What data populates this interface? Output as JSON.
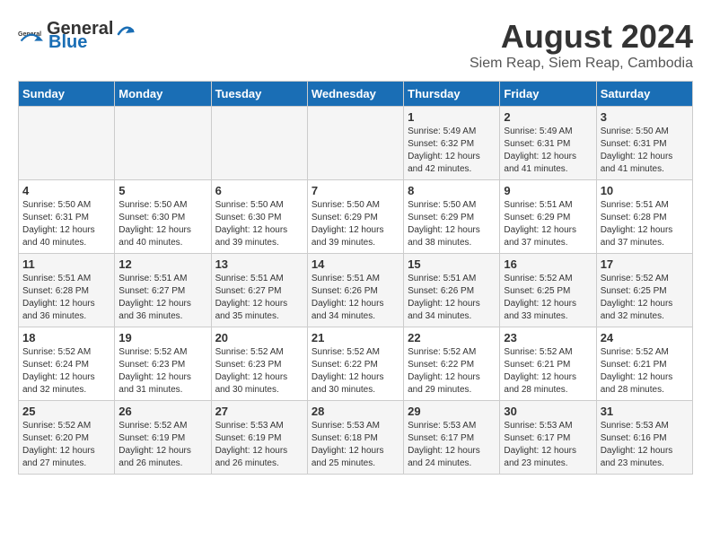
{
  "header": {
    "logo_general": "General",
    "logo_blue": "Blue",
    "month_year": "August 2024",
    "location": "Siem Reap, Siem Reap, Cambodia"
  },
  "days_of_week": [
    "Sunday",
    "Monday",
    "Tuesday",
    "Wednesday",
    "Thursday",
    "Friday",
    "Saturday"
  ],
  "weeks": [
    [
      {
        "day": "",
        "sunrise": "",
        "sunset": "",
        "daylight": ""
      },
      {
        "day": "",
        "sunrise": "",
        "sunset": "",
        "daylight": ""
      },
      {
        "day": "",
        "sunrise": "",
        "sunset": "",
        "daylight": ""
      },
      {
        "day": "",
        "sunrise": "",
        "sunset": "",
        "daylight": ""
      },
      {
        "day": "1",
        "sunrise": "Sunrise: 5:49 AM",
        "sunset": "Sunset: 6:32 PM",
        "daylight": "Daylight: 12 hours and 42 minutes."
      },
      {
        "day": "2",
        "sunrise": "Sunrise: 5:49 AM",
        "sunset": "Sunset: 6:31 PM",
        "daylight": "Daylight: 12 hours and 41 minutes."
      },
      {
        "day": "3",
        "sunrise": "Sunrise: 5:50 AM",
        "sunset": "Sunset: 6:31 PM",
        "daylight": "Daylight: 12 hours and 41 minutes."
      }
    ],
    [
      {
        "day": "4",
        "sunrise": "Sunrise: 5:50 AM",
        "sunset": "Sunset: 6:31 PM",
        "daylight": "Daylight: 12 hours and 40 minutes."
      },
      {
        "day": "5",
        "sunrise": "Sunrise: 5:50 AM",
        "sunset": "Sunset: 6:30 PM",
        "daylight": "Daylight: 12 hours and 40 minutes."
      },
      {
        "day": "6",
        "sunrise": "Sunrise: 5:50 AM",
        "sunset": "Sunset: 6:30 PM",
        "daylight": "Daylight: 12 hours and 39 minutes."
      },
      {
        "day": "7",
        "sunrise": "Sunrise: 5:50 AM",
        "sunset": "Sunset: 6:29 PM",
        "daylight": "Daylight: 12 hours and 39 minutes."
      },
      {
        "day": "8",
        "sunrise": "Sunrise: 5:50 AM",
        "sunset": "Sunset: 6:29 PM",
        "daylight": "Daylight: 12 hours and 38 minutes."
      },
      {
        "day": "9",
        "sunrise": "Sunrise: 5:51 AM",
        "sunset": "Sunset: 6:29 PM",
        "daylight": "Daylight: 12 hours and 37 minutes."
      },
      {
        "day": "10",
        "sunrise": "Sunrise: 5:51 AM",
        "sunset": "Sunset: 6:28 PM",
        "daylight": "Daylight: 12 hours and 37 minutes."
      }
    ],
    [
      {
        "day": "11",
        "sunrise": "Sunrise: 5:51 AM",
        "sunset": "Sunset: 6:28 PM",
        "daylight": "Daylight: 12 hours and 36 minutes."
      },
      {
        "day": "12",
        "sunrise": "Sunrise: 5:51 AM",
        "sunset": "Sunset: 6:27 PM",
        "daylight": "Daylight: 12 hours and 36 minutes."
      },
      {
        "day": "13",
        "sunrise": "Sunrise: 5:51 AM",
        "sunset": "Sunset: 6:27 PM",
        "daylight": "Daylight: 12 hours and 35 minutes."
      },
      {
        "day": "14",
        "sunrise": "Sunrise: 5:51 AM",
        "sunset": "Sunset: 6:26 PM",
        "daylight": "Daylight: 12 hours and 34 minutes."
      },
      {
        "day": "15",
        "sunrise": "Sunrise: 5:51 AM",
        "sunset": "Sunset: 6:26 PM",
        "daylight": "Daylight: 12 hours and 34 minutes."
      },
      {
        "day": "16",
        "sunrise": "Sunrise: 5:52 AM",
        "sunset": "Sunset: 6:25 PM",
        "daylight": "Daylight: 12 hours and 33 minutes."
      },
      {
        "day": "17",
        "sunrise": "Sunrise: 5:52 AM",
        "sunset": "Sunset: 6:25 PM",
        "daylight": "Daylight: 12 hours and 32 minutes."
      }
    ],
    [
      {
        "day": "18",
        "sunrise": "Sunrise: 5:52 AM",
        "sunset": "Sunset: 6:24 PM",
        "daylight": "Daylight: 12 hours and 32 minutes."
      },
      {
        "day": "19",
        "sunrise": "Sunrise: 5:52 AM",
        "sunset": "Sunset: 6:23 PM",
        "daylight": "Daylight: 12 hours and 31 minutes."
      },
      {
        "day": "20",
        "sunrise": "Sunrise: 5:52 AM",
        "sunset": "Sunset: 6:23 PM",
        "daylight": "Daylight: 12 hours and 30 minutes."
      },
      {
        "day": "21",
        "sunrise": "Sunrise: 5:52 AM",
        "sunset": "Sunset: 6:22 PM",
        "daylight": "Daylight: 12 hours and 30 minutes."
      },
      {
        "day": "22",
        "sunrise": "Sunrise: 5:52 AM",
        "sunset": "Sunset: 6:22 PM",
        "daylight": "Daylight: 12 hours and 29 minutes."
      },
      {
        "day": "23",
        "sunrise": "Sunrise: 5:52 AM",
        "sunset": "Sunset: 6:21 PM",
        "daylight": "Daylight: 12 hours and 28 minutes."
      },
      {
        "day": "24",
        "sunrise": "Sunrise: 5:52 AM",
        "sunset": "Sunset: 6:21 PM",
        "daylight": "Daylight: 12 hours and 28 minutes."
      }
    ],
    [
      {
        "day": "25",
        "sunrise": "Sunrise: 5:52 AM",
        "sunset": "Sunset: 6:20 PM",
        "daylight": "Daylight: 12 hours and 27 minutes."
      },
      {
        "day": "26",
        "sunrise": "Sunrise: 5:52 AM",
        "sunset": "Sunset: 6:19 PM",
        "daylight": "Daylight: 12 hours and 26 minutes."
      },
      {
        "day": "27",
        "sunrise": "Sunrise: 5:53 AM",
        "sunset": "Sunset: 6:19 PM",
        "daylight": "Daylight: 12 hours and 26 minutes."
      },
      {
        "day": "28",
        "sunrise": "Sunrise: 5:53 AM",
        "sunset": "Sunset: 6:18 PM",
        "daylight": "Daylight: 12 hours and 25 minutes."
      },
      {
        "day": "29",
        "sunrise": "Sunrise: 5:53 AM",
        "sunset": "Sunset: 6:17 PM",
        "daylight": "Daylight: 12 hours and 24 minutes."
      },
      {
        "day": "30",
        "sunrise": "Sunrise: 5:53 AM",
        "sunset": "Sunset: 6:17 PM",
        "daylight": "Daylight: 12 hours and 23 minutes."
      },
      {
        "day": "31",
        "sunrise": "Sunrise: 5:53 AM",
        "sunset": "Sunset: 6:16 PM",
        "daylight": "Daylight: 12 hours and 23 minutes."
      }
    ]
  ]
}
